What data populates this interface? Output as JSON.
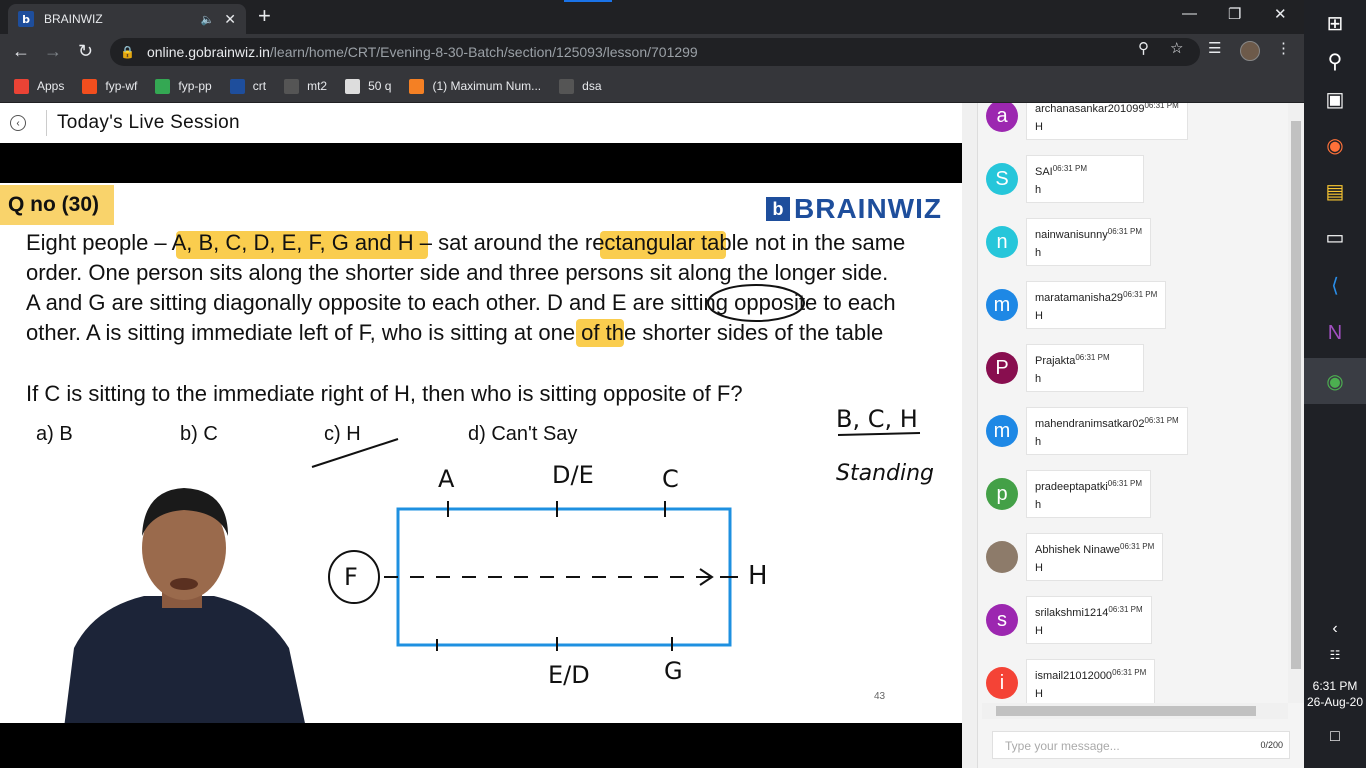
{
  "browser": {
    "tab_title": "BRAINWIZ",
    "url_host": "online.gobrainwiz.in",
    "url_path": "/learn/home/CRT/Evening-8-30-Batch/section/125093/lesson/701299",
    "bookmarks": [
      {
        "label": "Apps",
        "icon": "apps-grid-icon",
        "color": "#ea4335"
      },
      {
        "label": "fyp-wf",
        "icon": "figma-icon",
        "color": "#f24e1e"
      },
      {
        "label": "fyp-pp",
        "icon": "pp-icon",
        "color": "#34a853"
      },
      {
        "label": "crt",
        "icon": "brainwiz-icon",
        "color": "#1e4e9c"
      },
      {
        "label": "mt2",
        "icon": "cc-icon",
        "color": "#555555"
      },
      {
        "label": "50 q",
        "icon": "globe-icon",
        "color": "#dddddd"
      },
      {
        "label": "(1) Maximum Num...",
        "icon": "stackoverflow-icon",
        "color": "#f48024"
      },
      {
        "label": "dsa",
        "icon": "cc-icon",
        "color": "#555555"
      }
    ]
  },
  "page": {
    "title": "Today's Live Session"
  },
  "slide": {
    "qno": "Q no (30)",
    "brand": "BRAINWIZ",
    "question": "Eight people – A, B, C, D, E, F, G and H – sat around the rectangular table not in the same order. One person sits along the shorter side and three persons sit along the longer side. A and G are sitting diagonally opposite to each other. D and E are sitting opposite to each other. A is sitting immediate left of F, who is sitting at one of the shorter sides of the table",
    "question2": "If C is sitting to the immediate right of H, then who is sitting opposite of F?",
    "options": [
      "a) B",
      "b) C",
      "c) H",
      "d) Can't Say"
    ],
    "slide_number": "43",
    "handwriting": {
      "top_labels": [
        "A",
        "D/E",
        "C"
      ],
      "bottom_labels": [
        "E/D",
        "G"
      ],
      "left_label": "F",
      "right_label": "H",
      "side_note_1": "B, C, H",
      "side_note_2": "Standing"
    }
  },
  "chat": {
    "messages": [
      {
        "user": "archanasankar201099",
        "time": "06:31 PM",
        "text": "H",
        "initial": "a",
        "color": "#9c27b0"
      },
      {
        "user": "SAI",
        "time": "06:31 PM",
        "text": "h",
        "initial": "S",
        "color": "#26c6da"
      },
      {
        "user": "nainwanisunny",
        "time": "06:31 PM",
        "text": "h",
        "initial": "n",
        "color": "#26c6da"
      },
      {
        "user": "maratamanisha29",
        "time": "06:31 PM",
        "text": "H",
        "initial": "m",
        "color": "#1e88e5"
      },
      {
        "user": "Prajakta",
        "time": "06:31 PM",
        "text": "h",
        "initial": "P",
        "color": "#880e4f"
      },
      {
        "user": "mahendranimsatkar02",
        "time": "06:31 PM",
        "text": "h",
        "initial": "m",
        "color": "#1e88e5"
      },
      {
        "user": "pradeeptapatki",
        "time": "06:31 PM",
        "text": "h",
        "initial": "p",
        "color": "#43a047"
      },
      {
        "user": "Abhishek Ninawe",
        "time": "06:31 PM",
        "text": "H",
        "initial": "",
        "color": "#8d7b6a"
      },
      {
        "user": "srilakshmi1214",
        "time": "06:31 PM",
        "text": "H",
        "initial": "s",
        "color": "#9c27b0"
      },
      {
        "user": "ismail21012000",
        "time": "06:31 PM",
        "text": "H",
        "initial": "i",
        "color": "#f44336"
      }
    ],
    "input_placeholder": "Type your message...",
    "char_count": "0/200"
  },
  "taskbar": {
    "time": "6:31 PM",
    "date": "26-Aug-20"
  }
}
